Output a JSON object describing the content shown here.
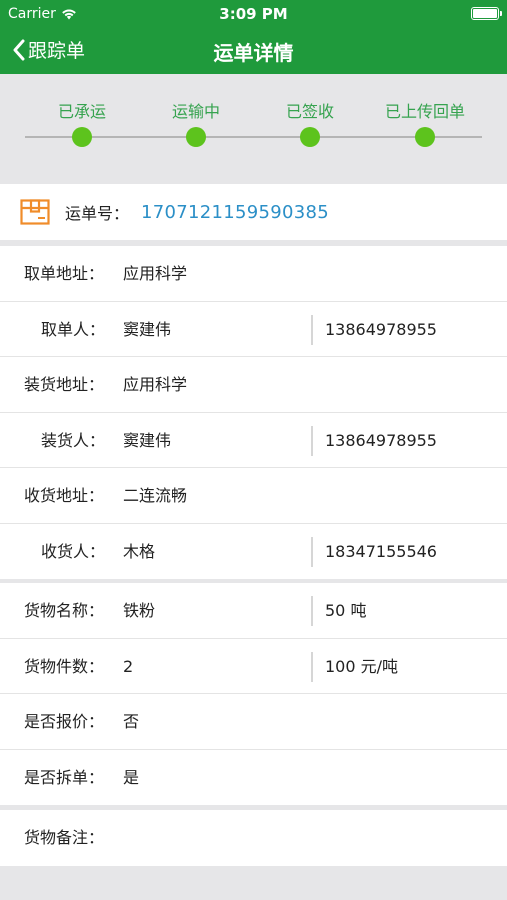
{
  "status_bar": {
    "carrier": "Carrier",
    "time": "3:09 PM"
  },
  "nav": {
    "back_label": "跟踪单",
    "title": "运单详情"
  },
  "progress": {
    "steps": [
      "已承运",
      "运输中",
      "已签收",
      "已上传回单"
    ]
  },
  "order": {
    "label": "运单号：",
    "number": "1707121159590385"
  },
  "addresses": {
    "pickup_address": {
      "label": "取单地址：",
      "value": "应用科学"
    },
    "pickup_person": {
      "label": "取单人：",
      "name": "窦建伟",
      "phone": "13864978955"
    },
    "loading_address": {
      "label": "装货地址：",
      "value": "应用科学"
    },
    "loading_person": {
      "label": "装货人：",
      "name": "窦建伟",
      "phone": "13864978955"
    },
    "receiving_address": {
      "label": "收货地址：",
      "value": "二连流畅"
    },
    "receiver": {
      "label": "收货人：",
      "name": "木格",
      "phone": "18347155546"
    }
  },
  "cargo": {
    "name": {
      "label": "货物名称：",
      "value": "铁粉",
      "extra": "50 吨"
    },
    "count": {
      "label": "货物件数：",
      "value": "2",
      "extra": "100 元/吨"
    },
    "insured": {
      "label": "是否报价：",
      "value": "否"
    },
    "split": {
      "label": "是否拆单：",
      "value": "是"
    }
  },
  "notes": {
    "label": "货物备注："
  },
  "colors": {
    "brand_green": "#1f9a3c",
    "step_dot": "#5dc31d",
    "order_number": "#2b8fc7",
    "box_icon": "#f08c2a"
  },
  "icons": {
    "back": "chevron-left-icon",
    "wifi": "wifi-icon",
    "battery": "battery-icon",
    "box": "package-box-icon"
  }
}
